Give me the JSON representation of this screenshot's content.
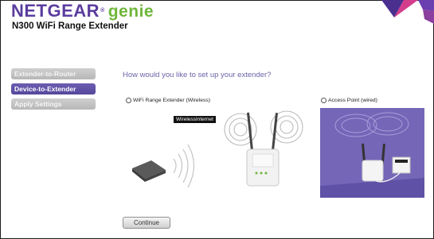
{
  "header": {
    "brand": "NETGEAR",
    "trademark": "®",
    "brand_suffix": "genie",
    "product": "N300 WiFi Range Extender"
  },
  "nav": {
    "items": [
      {
        "label": "Extender-to-Router",
        "state": "inactive"
      },
      {
        "label": "Device-to-Extender",
        "state": "active"
      },
      {
        "label": "Apply Settings",
        "state": "inactive"
      }
    ]
  },
  "main": {
    "question": "How would you like to set up your extender?",
    "option_wireless": "WiFi Range Extender (Wireless)",
    "option_ap": "Access Point (wired)",
    "wireless_internet_label": "WirelessInternet",
    "continue_label": "Continue"
  },
  "colors": {
    "brand_purple": "#5b3d9e",
    "genie_green": "#6fb63a",
    "nav_active": "#5a4ca0",
    "panel_purple": "#7566b8"
  }
}
